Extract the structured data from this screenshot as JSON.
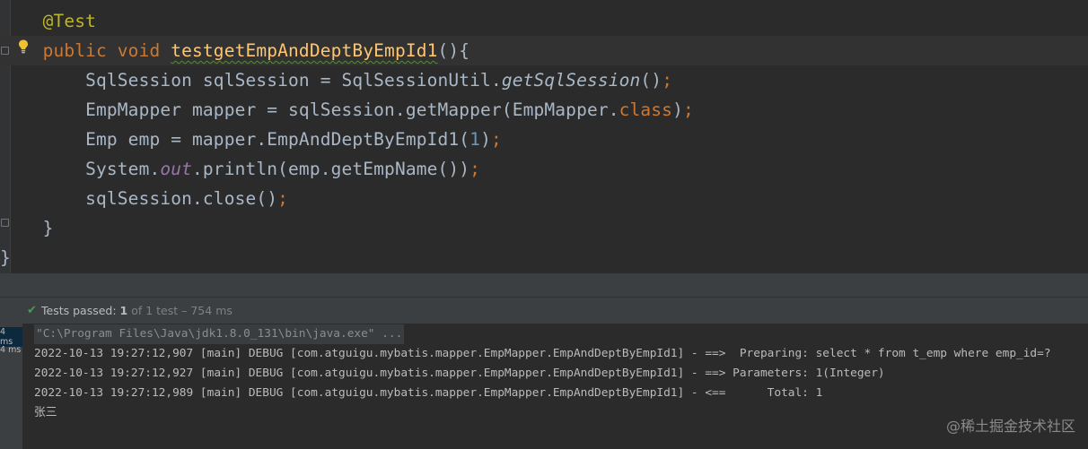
{
  "editor": {
    "lines": [
      {
        "indent": "    ",
        "annotation": "@Test"
      },
      {
        "indent": "    ",
        "kw_public": "public",
        "kw_void": "void",
        "method": "testgetEmpAndDeptByEmpId1",
        "tail": "(){"
      },
      {
        "indent": "        ",
        "pre": "SqlSession sqlSession = SqlSessionUtil.",
        "call": "getSqlSession",
        "post": "()",
        "semi": ";"
      },
      {
        "indent": "        ",
        "pre": "EmpMapper mapper = sqlSession.getMapper(EmpMapper.",
        "kw": "class",
        "post": ")",
        "semi": ";"
      },
      {
        "indent": "        ",
        "pre": "Emp emp = mapper.EmpAndDeptByEmpId1(",
        "num": "1",
        "post": ")",
        "semi": ";"
      },
      {
        "indent": "        ",
        "pre": "System.",
        "static": "out",
        "post": ".println(emp.getEmpName())",
        "semi": ";"
      },
      {
        "indent": "        ",
        "pre": "sqlSession.close()",
        "semi": ";"
      },
      {
        "indent": "    ",
        "text": "}"
      },
      {
        "indent": "",
        "text": "}"
      }
    ],
    "icons": {
      "bulb": "lightbulb-icon",
      "fold_open": "fold-open-icon",
      "fold_close": "fold-close-icon"
    }
  },
  "run_panel": {
    "status": {
      "prefix": "Tests passed: ",
      "passed": "1",
      "rest": " of 1 test – 754 ms"
    },
    "test_times": [
      "4 ms",
      "4 ms"
    ],
    "console": [
      "\"C:\\Program Files\\Java\\jdk1.8.0_131\\bin\\java.exe\" ...",
      "2022-10-13 19:27:12,907 [main] DEBUG [com.atguigu.mybatis.mapper.EmpMapper.EmpAndDeptByEmpId1] - ==>  Preparing: select * from t_emp where emp_id=?",
      "2022-10-13 19:27:12,927 [main] DEBUG [com.atguigu.mybatis.mapper.EmpMapper.EmpAndDeptByEmpId1] - ==> Parameters: 1(Integer)",
      "2022-10-13 19:27:12,989 [main] DEBUG [com.atguigu.mybatis.mapper.EmpMapper.EmpAndDeptByEmpId1] - <==      Total: 1",
      "张三"
    ]
  },
  "watermark": "@稀土掘金技术社区",
  "colors": {
    "background": "#2b2b2b",
    "keyword": "#cc7832",
    "annotation": "#bbb529",
    "method": "#ffc66d",
    "number": "#6897bb",
    "static_field": "#9876aa",
    "passed": "#499c54"
  }
}
